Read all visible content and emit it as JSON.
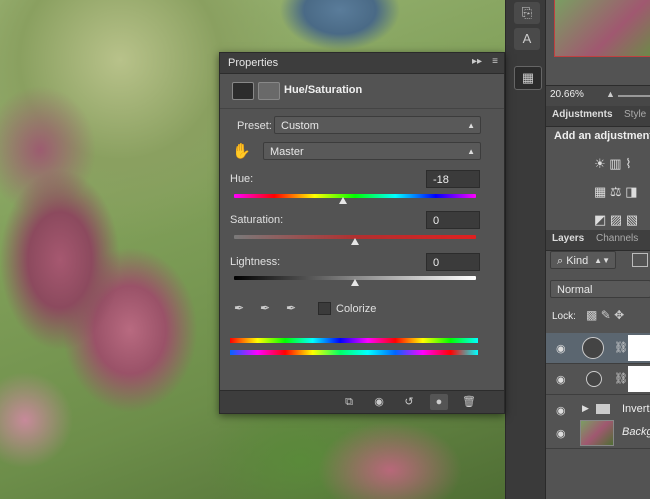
{
  "properties": {
    "panel_title": "Properties",
    "adjustment_title": "Hue/Saturation",
    "preset_label": "Preset:",
    "preset_value": "Custom",
    "channel_value": "Master",
    "hue_label": "Hue:",
    "hue_value": "-18",
    "saturation_label": "Saturation:",
    "saturation_value": "0",
    "lightness_label": "Lightness:",
    "lightness_value": "0",
    "colorize_label": "Colorize"
  },
  "sliders": {
    "hue_fraction": 0.45,
    "saturation_fraction": 0.5,
    "lightness_fraction": 0.5
  },
  "right": {
    "zoom": "20.66%",
    "adjustments_tab": "Adjustments",
    "styles_tab": "Style",
    "add_adjustment": "Add an adjustment",
    "layers_tab": "Layers",
    "channels_tab": "Channels",
    "kind_label": "Kind",
    "blend_mode": "Normal",
    "lock_label": "Lock:",
    "layer_group": "Invert",
    "layer_background": "Backgr"
  },
  "icons": [
    "eye-icon",
    "trash-icon",
    "reset-icon",
    "clip-icon",
    "eyedropper-icon",
    "hand-icon",
    "visibility-icon"
  ]
}
